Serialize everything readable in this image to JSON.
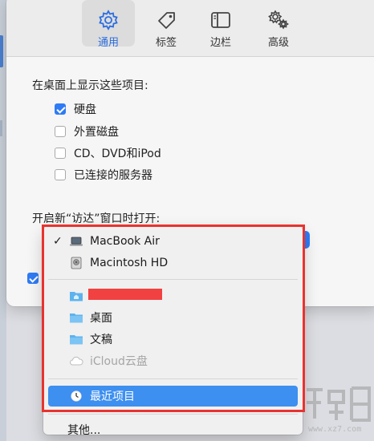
{
  "toolbar": {
    "tabs": [
      {
        "label": "通用",
        "icon": "gear-icon",
        "active": true
      },
      {
        "label": "标签",
        "icon": "tag-icon",
        "active": false
      },
      {
        "label": "边栏",
        "icon": "sidebar-icon",
        "active": false
      },
      {
        "label": "高级",
        "icon": "gears-icon",
        "active": false
      }
    ]
  },
  "general": {
    "desktop_section_title": "在桌面上显示这些项目:",
    "desktop_items": [
      {
        "label": "硬盘",
        "checked": true
      },
      {
        "label": "外置磁盘",
        "checked": false
      },
      {
        "label": "CD、DVD和iPod",
        "checked": false
      },
      {
        "label": "已连接的服务器",
        "checked": false
      }
    ],
    "new_window_label": "开启新“访达”窗口时打开:",
    "lower_checkbox_checked": true
  },
  "menu": {
    "items": [
      {
        "label": "MacBook Air",
        "icon": "laptop-icon",
        "checked": true
      },
      {
        "label": "Macintosh HD",
        "icon": "harddisk-icon",
        "checked": false
      },
      {
        "label": "",
        "icon": "home-folder-icon",
        "redacted": true
      },
      {
        "label": "桌面",
        "icon": "folder-icon"
      },
      {
        "label": "文稿",
        "icon": "folder-icon"
      },
      {
        "label": "iCloud云盘",
        "icon": "cloud-icon",
        "disabled": true
      },
      {
        "label": "最近项目",
        "icon": "clock-icon",
        "selected": true
      },
      {
        "label": "其他...",
        "icon": ""
      }
    ]
  },
  "colors": {
    "accent": "#2f7bf5",
    "menu_selected": "#3d8ff0",
    "highlight_frame": "#e8332f",
    "redaction": "#f24141"
  },
  "watermark": {
    "text": "www.xz7.com"
  }
}
